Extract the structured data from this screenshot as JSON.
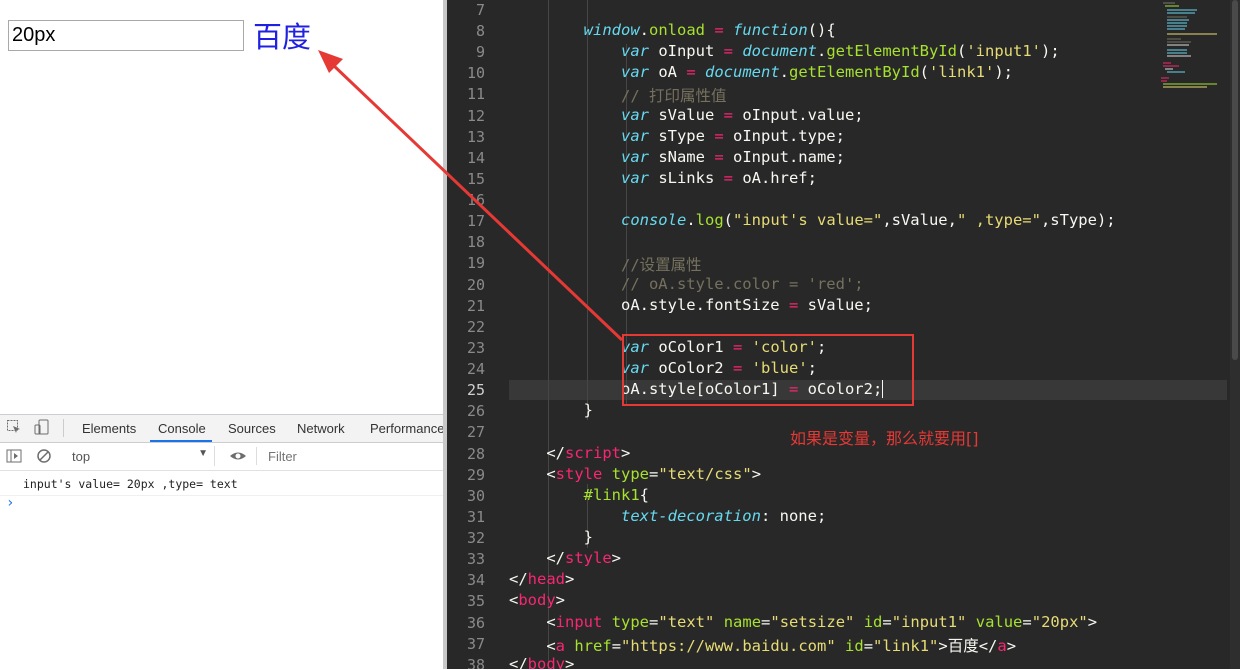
{
  "browser": {
    "input_value": "20px",
    "link_text": "百度"
  },
  "devtools": {
    "tabs": [
      "Elements",
      "Console",
      "Sources",
      "Network",
      "Performance"
    ],
    "active_tab": "Console",
    "context": "top",
    "filter_placeholder": "Filter",
    "log_line": "input's value= 20px  ,type= text",
    "prompt": "›"
  },
  "editor": {
    "line_numbers": [
      "7",
      "8",
      "9",
      "10",
      "11",
      "12",
      "13",
      "14",
      "15",
      "16",
      "17",
      "18",
      "19",
      "20",
      "21",
      "22",
      "23",
      "24",
      "25",
      "26",
      "27",
      "28",
      "29",
      "30",
      "31",
      "32",
      "33",
      "34",
      "35",
      "36",
      "37",
      "38"
    ],
    "current_line": "25"
  },
  "annotation": {
    "text": "如果是变量，那么就要用[]",
    "color": "#e53935"
  },
  "colors": {
    "editor_bg": "#282828",
    "keyword": "#66d9ef",
    "string": "#e6db74",
    "comment": "#75715e",
    "tag": "#f92672",
    "attr": "#a6e22e"
  }
}
